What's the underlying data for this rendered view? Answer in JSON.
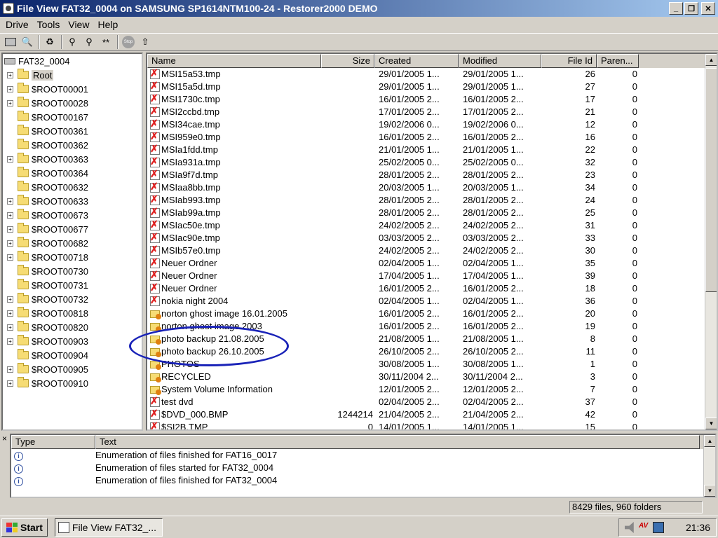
{
  "window": {
    "title": "File View FAT32_0004 on SAMSUNG SP1614NTM100-24 - Restorer2000 DEMO"
  },
  "menu": [
    "Drive",
    "Tools",
    "View",
    "Help"
  ],
  "toolbar": {
    "stop_label": "Stop"
  },
  "tree": {
    "root_drive": "FAT32_0004",
    "items": [
      {
        "label": "Root",
        "expandable": true,
        "selected": true
      },
      {
        "label": "$ROOT00001",
        "expandable": true
      },
      {
        "label": "$ROOT00028",
        "expandable": true
      },
      {
        "label": "$ROOT00167",
        "expandable": false
      },
      {
        "label": "$ROOT00361",
        "expandable": false
      },
      {
        "label": "$ROOT00362",
        "expandable": false
      },
      {
        "label": "$ROOT00363",
        "expandable": true
      },
      {
        "label": "$ROOT00364",
        "expandable": false
      },
      {
        "label": "$ROOT00632",
        "expandable": false
      },
      {
        "label": "$ROOT00633",
        "expandable": true
      },
      {
        "label": "$ROOT00673",
        "expandable": true
      },
      {
        "label": "$ROOT00677",
        "expandable": true
      },
      {
        "label": "$ROOT00682",
        "expandable": true
      },
      {
        "label": "$ROOT00718",
        "expandable": true
      },
      {
        "label": "$ROOT00730",
        "expandable": false
      },
      {
        "label": "$ROOT00731",
        "expandable": false
      },
      {
        "label": "$ROOT00732",
        "expandable": true
      },
      {
        "label": "$ROOT00818",
        "expandable": true
      },
      {
        "label": "$ROOT00820",
        "expandable": true
      },
      {
        "label": "$ROOT00903",
        "expandable": true
      },
      {
        "label": "$ROOT00904",
        "expandable": false
      },
      {
        "label": "$ROOT00905",
        "expandable": true
      },
      {
        "label": "$ROOT00910",
        "expandable": true
      }
    ]
  },
  "files": {
    "columns": [
      "Name",
      "Size",
      "Created",
      "Modified",
      "File Id",
      "Paren..."
    ],
    "rows": [
      {
        "name": "MSI15a53.tmp",
        "type": "file",
        "size": "",
        "created": "29/01/2005 1...",
        "modified": "29/01/2005 1...",
        "id": "26",
        "parent": "0"
      },
      {
        "name": "MSI15a5d.tmp",
        "type": "file",
        "size": "",
        "created": "29/01/2005 1...",
        "modified": "29/01/2005 1...",
        "id": "27",
        "parent": "0"
      },
      {
        "name": "MSI1730c.tmp",
        "type": "file",
        "size": "",
        "created": "16/01/2005 2...",
        "modified": "16/01/2005 2...",
        "id": "17",
        "parent": "0"
      },
      {
        "name": "MSI2ccbd.tmp",
        "type": "file",
        "size": "",
        "created": "17/01/2005 2...",
        "modified": "17/01/2005 2...",
        "id": "21",
        "parent": "0"
      },
      {
        "name": "MSI34cae.tmp",
        "type": "file",
        "size": "",
        "created": "19/02/2006 0...",
        "modified": "19/02/2006 0...",
        "id": "12",
        "parent": "0"
      },
      {
        "name": "MSI959e0.tmp",
        "type": "file",
        "size": "",
        "created": "16/01/2005 2...",
        "modified": "16/01/2005 2...",
        "id": "16",
        "parent": "0"
      },
      {
        "name": "MSIa1fdd.tmp",
        "type": "file",
        "size": "",
        "created": "21/01/2005 1...",
        "modified": "21/01/2005 1...",
        "id": "22",
        "parent": "0"
      },
      {
        "name": "MSIa931a.tmp",
        "type": "file",
        "size": "",
        "created": "25/02/2005 0...",
        "modified": "25/02/2005 0...",
        "id": "32",
        "parent": "0"
      },
      {
        "name": "MSIa9f7d.tmp",
        "type": "file",
        "size": "",
        "created": "28/01/2005 2...",
        "modified": "28/01/2005 2...",
        "id": "23",
        "parent": "0"
      },
      {
        "name": "MSIaa8bb.tmp",
        "type": "file",
        "size": "",
        "created": "20/03/2005 1...",
        "modified": "20/03/2005 1...",
        "id": "34",
        "parent": "0"
      },
      {
        "name": "MSIab993.tmp",
        "type": "file",
        "size": "",
        "created": "28/01/2005 2...",
        "modified": "28/01/2005 2...",
        "id": "24",
        "parent": "0"
      },
      {
        "name": "MSIab99a.tmp",
        "type": "file",
        "size": "",
        "created": "28/01/2005 2...",
        "modified": "28/01/2005 2...",
        "id": "25",
        "parent": "0"
      },
      {
        "name": "MSIac50e.tmp",
        "type": "file",
        "size": "",
        "created": "24/02/2005 2...",
        "modified": "24/02/2005 2...",
        "id": "31",
        "parent": "0"
      },
      {
        "name": "MSIac90e.tmp",
        "type": "file",
        "size": "",
        "created": "03/03/2005 2...",
        "modified": "03/03/2005 2...",
        "id": "33",
        "parent": "0"
      },
      {
        "name": "MSIb57e0.tmp",
        "type": "file",
        "size": "",
        "created": "24/02/2005 2...",
        "modified": "24/02/2005 2...",
        "id": "30",
        "parent": "0"
      },
      {
        "name": "Neuer Ordner",
        "type": "file",
        "size": "",
        "created": "02/04/2005 1...",
        "modified": "02/04/2005 1...",
        "id": "35",
        "parent": "0"
      },
      {
        "name": "Neuer Ordner",
        "type": "file",
        "size": "",
        "created": "17/04/2005 1...",
        "modified": "17/04/2005 1...",
        "id": "39",
        "parent": "0"
      },
      {
        "name": "Neuer Ordner",
        "type": "file",
        "size": "",
        "created": "16/01/2005 2...",
        "modified": "16/01/2005 2...",
        "id": "18",
        "parent": "0"
      },
      {
        "name": "nokia night 2004",
        "type": "file",
        "size": "",
        "created": "02/04/2005 1...",
        "modified": "02/04/2005 1...",
        "id": "36",
        "parent": "0"
      },
      {
        "name": "norton ghost image 16.01.2005",
        "type": "dir",
        "size": "",
        "created": "16/01/2005 2...",
        "modified": "16/01/2005 2...",
        "id": "20",
        "parent": "0"
      },
      {
        "name": "norton ghost image 2003",
        "type": "dir",
        "size": "",
        "created": "16/01/2005 2...",
        "modified": "16/01/2005 2...",
        "id": "19",
        "parent": "0"
      },
      {
        "name": "photo backup 21.08.2005",
        "type": "dir",
        "size": "",
        "created": "21/08/2005 1...",
        "modified": "21/08/2005 1...",
        "id": "8",
        "parent": "0"
      },
      {
        "name": "photo backup 26.10.2005",
        "type": "dir",
        "size": "",
        "created": "26/10/2005 2...",
        "modified": "26/10/2005 2...",
        "id": "11",
        "parent": "0"
      },
      {
        "name": "PHOTOS",
        "type": "dir",
        "size": "",
        "created": "30/08/2005 1...",
        "modified": "30/08/2005 1...",
        "id": "1",
        "parent": "0"
      },
      {
        "name": "RECYCLED",
        "type": "dir",
        "size": "",
        "created": "30/11/2004 2...",
        "modified": "30/11/2004 2...",
        "id": "3",
        "parent": "0"
      },
      {
        "name": "System Volume Information",
        "type": "dir",
        "size": "",
        "created": "12/01/2005 2...",
        "modified": "12/01/2005 2...",
        "id": "7",
        "parent": "0"
      },
      {
        "name": "test dvd",
        "type": "file",
        "size": "",
        "created": "02/04/2005 2...",
        "modified": "02/04/2005 2...",
        "id": "37",
        "parent": "0"
      },
      {
        "name": "$DVD_000.BMP",
        "type": "file",
        "size": "1244214",
        "created": "21/04/2005 2...",
        "modified": "21/04/2005 2...",
        "id": "42",
        "parent": "0"
      },
      {
        "name": "$SI2B.TMP",
        "type": "file",
        "size": "0",
        "created": "14/01/2005 1...",
        "modified": "14/01/2005 1...",
        "id": "15",
        "parent": "0"
      }
    ]
  },
  "log": {
    "columns": [
      "Type",
      "Text"
    ],
    "rows": [
      {
        "text": "Enumeration of files finished for FAT16_0017"
      },
      {
        "text": "Enumeration of files started for FAT32_0004"
      },
      {
        "text": "Enumeration of files finished for FAT32_0004"
      }
    ]
  },
  "status": {
    "summary": "8429 files, 960 folders"
  },
  "taskbar": {
    "start_label": "Start",
    "task_label": "File View FAT32_...",
    "clock": "21:36"
  },
  "colors": {
    "title_start": "#0a246a",
    "title_end": "#a6caf0",
    "annotation": "#1a23b8"
  }
}
